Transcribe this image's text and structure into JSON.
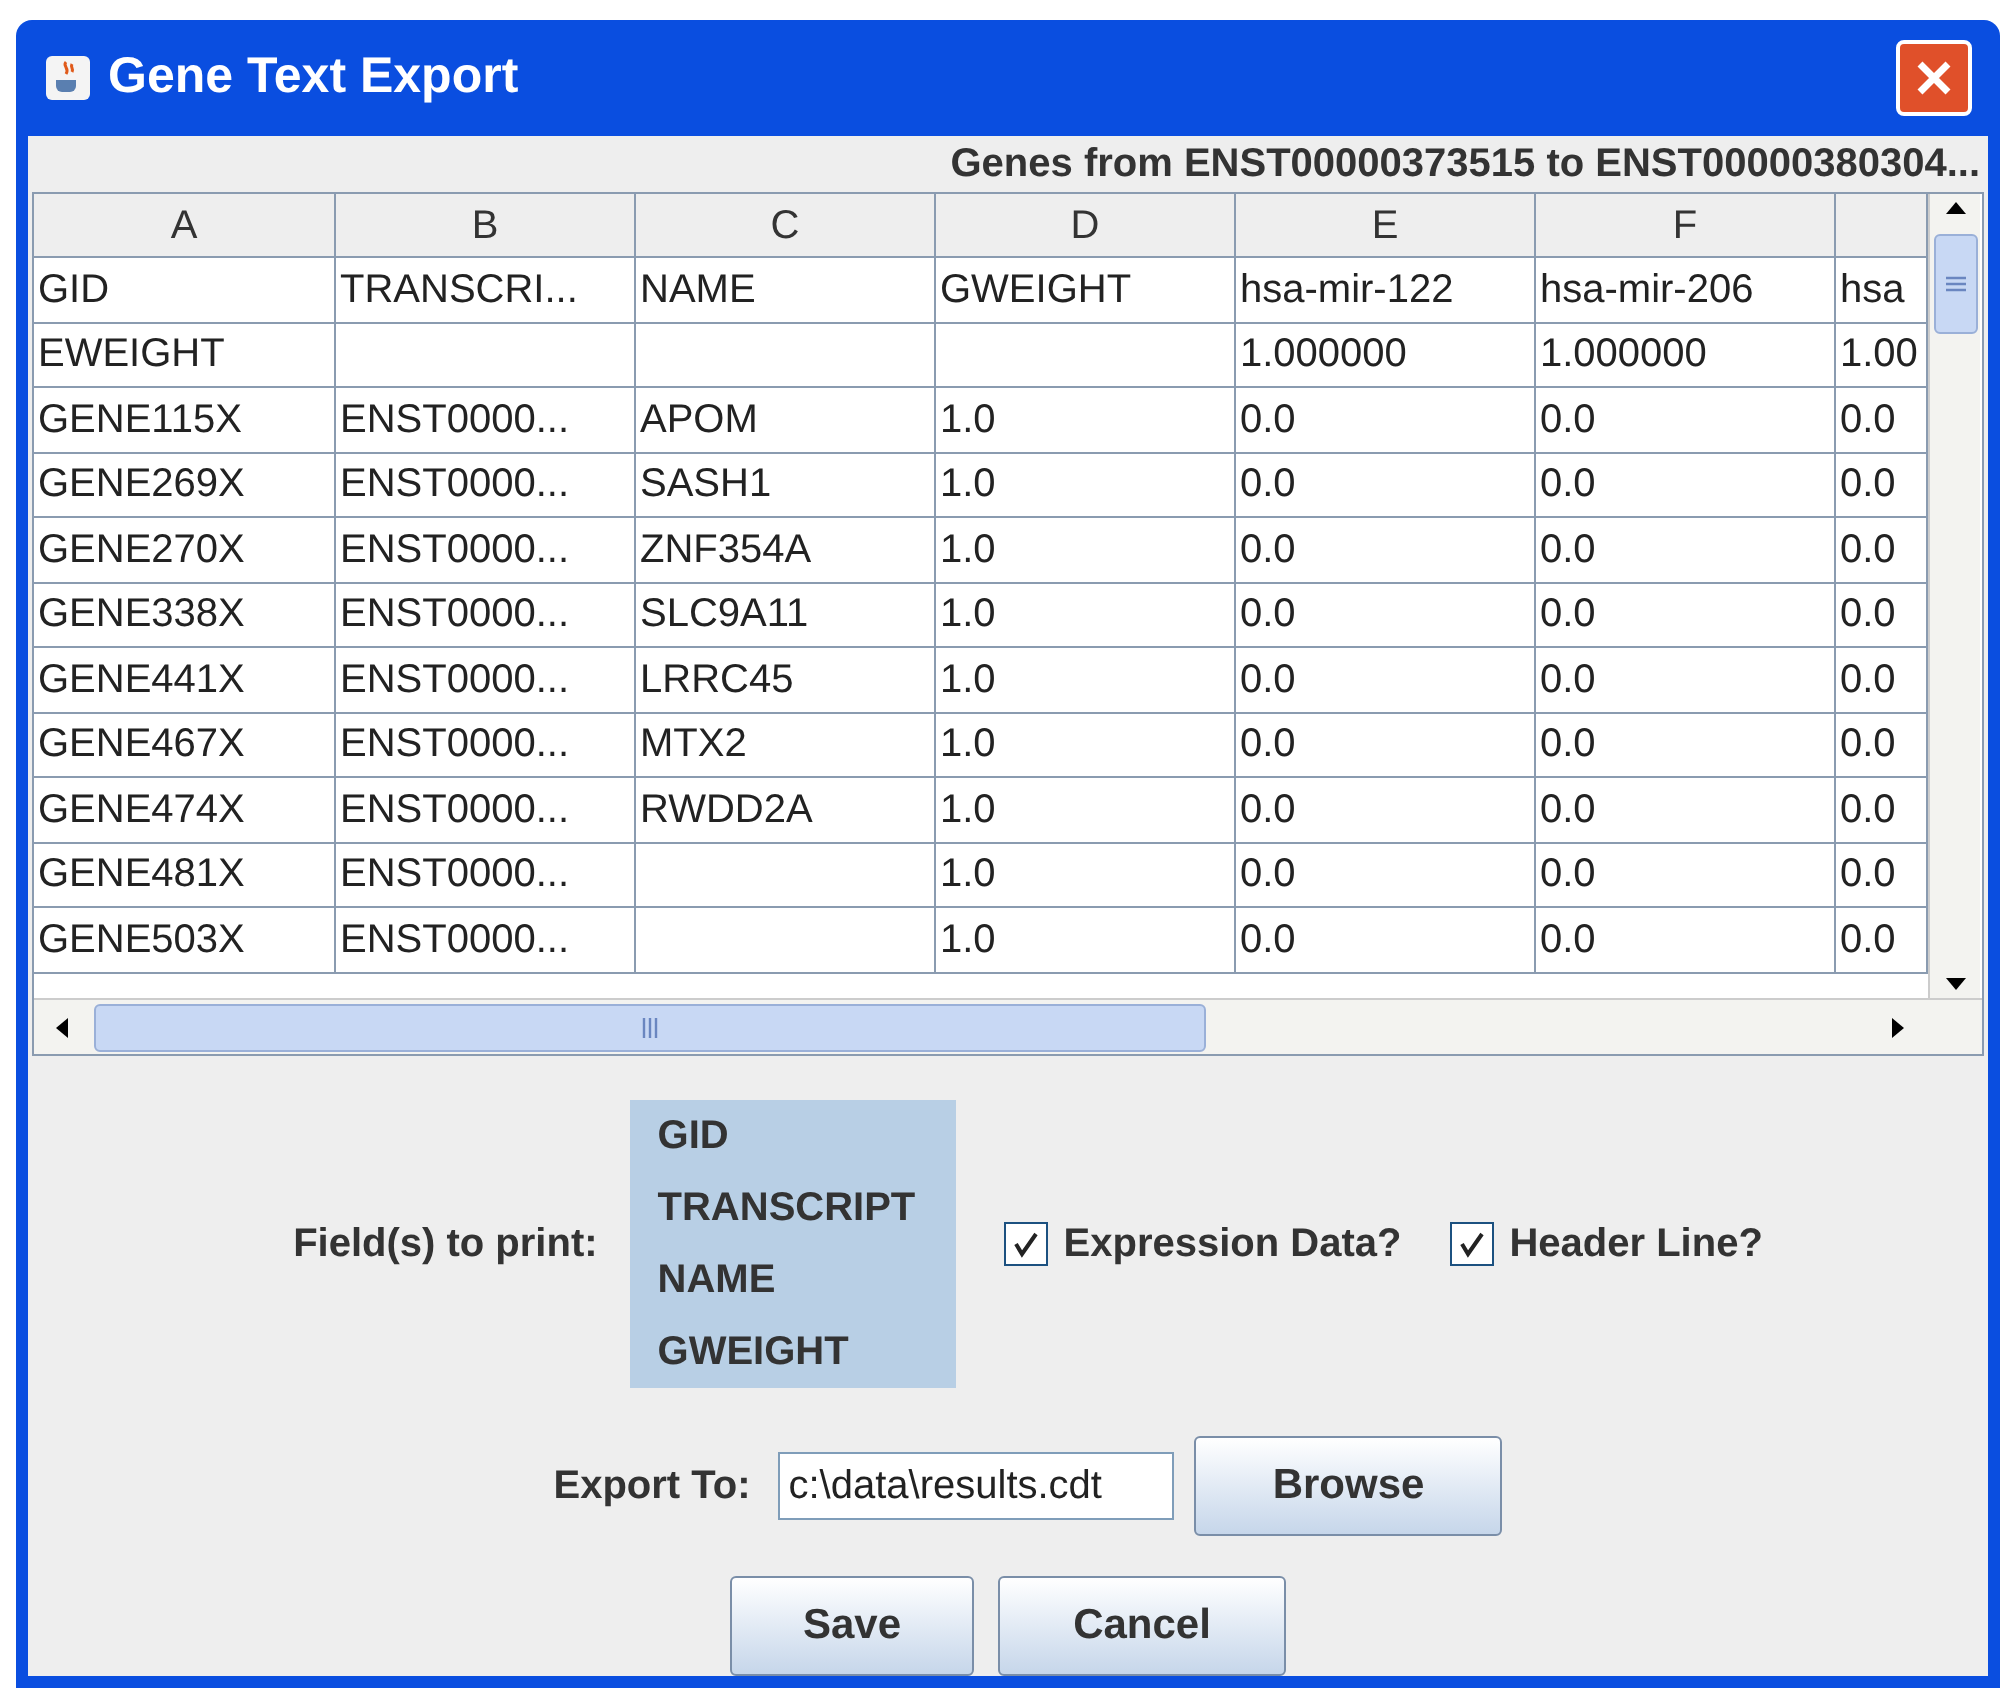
{
  "window": {
    "title": "Gene Text Export"
  },
  "caption": "Genes from ENST00000373515 to ENST00000380304...",
  "table": {
    "columns": [
      "A",
      "B",
      "C",
      "D",
      "E",
      "F"
    ],
    "rows": [
      [
        "GID",
        "TRANSCRI...",
        "NAME",
        "GWEIGHT",
        "hsa-mir-122",
        "hsa-mir-206",
        "hsa"
      ],
      [
        "EWEIGHT",
        "",
        "",
        "",
        "1.000000",
        "1.000000",
        "1.00"
      ],
      [
        "GENE115X",
        "ENST0000...",
        "APOM",
        "1.0",
        "0.0",
        "0.0",
        "0.0"
      ],
      [
        "GENE269X",
        "ENST0000...",
        "SASH1",
        "1.0",
        "0.0",
        "0.0",
        "0.0"
      ],
      [
        "GENE270X",
        "ENST0000...",
        "ZNF354A",
        "1.0",
        "0.0",
        "0.0",
        "0.0"
      ],
      [
        "GENE338X",
        "ENST0000...",
        "SLC9A11",
        "1.0",
        "0.0",
        "0.0",
        "0.0"
      ],
      [
        "GENE441X",
        "ENST0000...",
        "LRRC45",
        "1.0",
        "0.0",
        "0.0",
        "0.0"
      ],
      [
        "GENE467X",
        "ENST0000...",
        "MTX2",
        "1.0",
        "0.0",
        "0.0",
        "0.0"
      ],
      [
        "GENE474X",
        "ENST0000...",
        "RWDD2A",
        "1.0",
        "0.0",
        "0.0",
        "0.0"
      ],
      [
        "GENE481X",
        "ENST0000...",
        "",
        "1.0",
        "0.0",
        "0.0",
        "0.0"
      ],
      [
        "GENE503X",
        "ENST0000...",
        "",
        "1.0",
        "0.0",
        "0.0",
        "0.0"
      ]
    ]
  },
  "fields_label": "Field(s) to print:",
  "fields": [
    {
      "label": "GID",
      "selected": true
    },
    {
      "label": "TRANSCRIPT",
      "selected": true
    },
    {
      "label": "NAME",
      "selected": true
    },
    {
      "label": "GWEIGHT",
      "selected": true
    }
  ],
  "checkboxes": [
    {
      "label": "Expression Data?",
      "checked": true
    },
    {
      "label": "Header Line?",
      "checked": true
    }
  ],
  "export": {
    "label": "Export To:",
    "value": "c:\\data\\results.cdt",
    "browse": "Browse"
  },
  "buttons": [
    "Save",
    "Cancel"
  ]
}
